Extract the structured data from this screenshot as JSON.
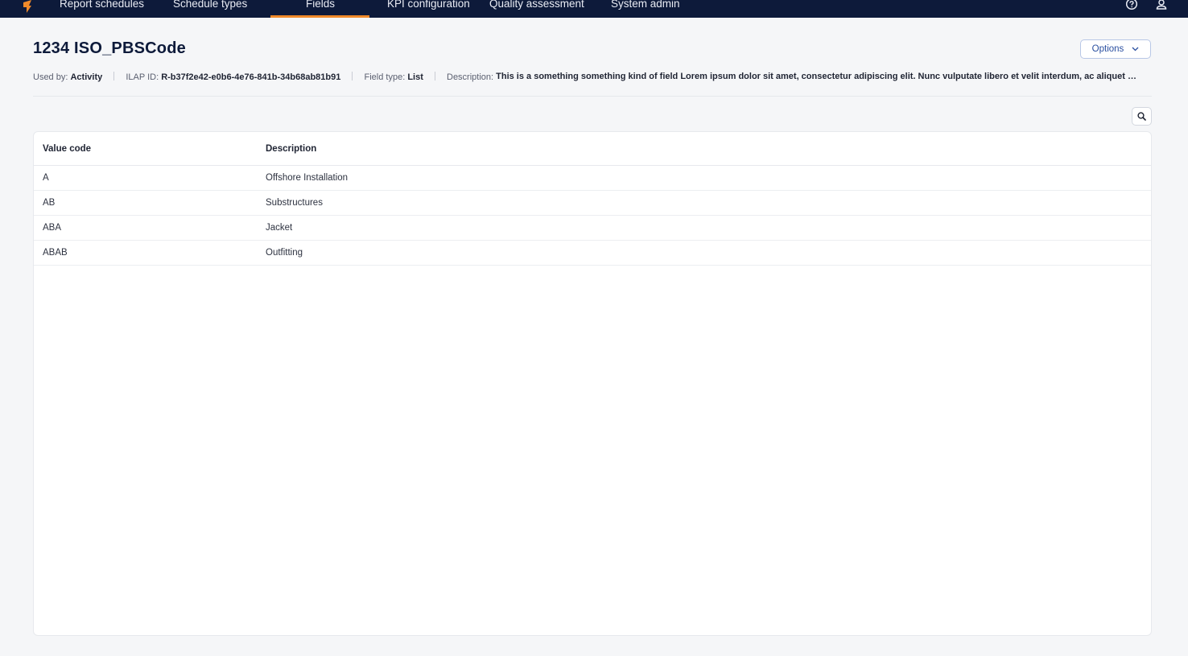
{
  "nav": {
    "items": [
      {
        "label": "Report schedules",
        "active": false
      },
      {
        "label": "Schedule types",
        "active": false
      },
      {
        "label": "Fields",
        "active": true
      },
      {
        "label": "KPI configuration",
        "active": false
      },
      {
        "label": "Quality assessment",
        "active": false
      },
      {
        "label": "System admin",
        "active": false
      }
    ],
    "icons": {
      "help": "help-circle-icon",
      "user": "user-icon",
      "logo": "app-logo-icon"
    }
  },
  "header": {
    "title": "1234 ISO_PBSCode",
    "options_label": "Options"
  },
  "meta": {
    "used_by_label": "Used by:",
    "used_by_value": "Activity",
    "ilap_label": "ILAP ID:",
    "ilap_value": "R-b37f2e42-e0b6-4e76-841b-34b68ab81b91",
    "field_type_label": "Field type:",
    "field_type_value": "List",
    "description_label": "Description:",
    "description_value": "This is a something something kind of field Lorem ipsum dolor sit amet, consectetur adipiscing elit. Nunc vulputate libero et velit interdum, ac aliquet odio mattis."
  },
  "table": {
    "headers": {
      "code": "Value code",
      "description": "Description"
    },
    "rows": [
      {
        "code": "A",
        "description": "Offshore Installation"
      },
      {
        "code": "AB",
        "description": "Substructures"
      },
      {
        "code": "ABA",
        "description": "Jacket"
      },
      {
        "code": "ABAB",
        "description": "Outfitting"
      }
    ]
  },
  "colors": {
    "nav_bg": "#0d1a3a",
    "accent": "#f08a2a",
    "link": "#2a4fa0"
  }
}
